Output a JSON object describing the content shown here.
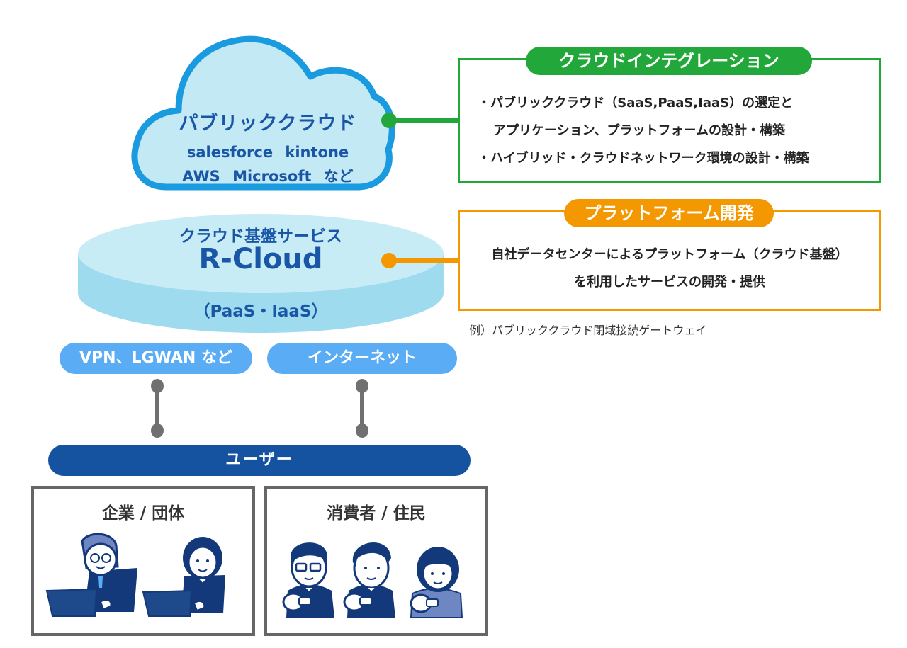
{
  "public_cloud": {
    "title": "パブリッククラウド",
    "services_line1": "salesforce kintone",
    "services_line2": "AWS Microsoft など"
  },
  "rcloud": {
    "subtitle": "クラウド基盤サービス",
    "title": "R-Cloud",
    "note": "（PaaS・IaaS）"
  },
  "integration": {
    "label": "クラウドインテグレーション",
    "lines": [
      "・パブリッククラウド（SaaS,PaaS,IaaS）の選定と",
      "アプリケーション、プラットフォームの設計・構築",
      "・ハイブリッド・クラウドネットワーク環境の設計・構築"
    ],
    "color": "#22a83a"
  },
  "platform": {
    "label": "プラットフォーム開発",
    "lines": [
      "自社データセンターによるプラットフォーム（クラウド基盤）",
      "を利用したサービスの開発・提供"
    ],
    "example": "例）パブリッククラウド閉域接続ゲートウェイ",
    "color": "#f39800"
  },
  "networks": [
    {
      "label": "VPN、LGWAN など"
    },
    {
      "label": "インターネット"
    }
  ],
  "users": {
    "label": "ユーザー"
  },
  "groups": [
    {
      "title": "企業 / 団体",
      "icons": [
        "businessman-laptop-icon",
        "businesswoman-laptop-icon"
      ]
    },
    {
      "title": "消費者 / 住民",
      "icons": [
        "man-glasses-phone-icon",
        "man-phone-icon",
        "woman-phone-icon"
      ]
    }
  ],
  "colors": {
    "cloud_fill": "#c3e9f5",
    "cloud_stroke": "#1a9be0",
    "text_blue": "#1a56a6",
    "pill_blue": "#5aacf5",
    "user_bar": "#1553a0",
    "connector_gray": "#707070",
    "figure_navy": "#13397a"
  }
}
